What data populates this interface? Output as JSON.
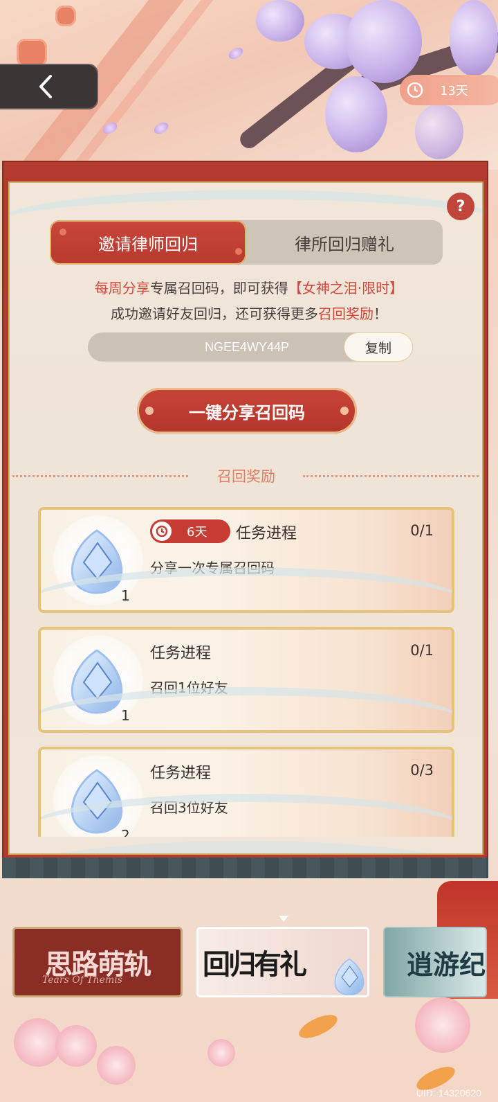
{
  "header": {
    "back_icon": "chevron-left-icon",
    "timer_icon": "clock-icon",
    "timer_text": "13天"
  },
  "panel": {
    "help_icon": "question-icon",
    "help_label": "?",
    "tabs": [
      {
        "label": "邀请律师回归",
        "active": true
      },
      {
        "label": "律所回归赠礼",
        "active": false
      }
    ],
    "description": {
      "line1": {
        "a": "每周",
        "b": "分享",
        "c": "专属召回码，即可获得",
        "d": "【女神之泪·限时】"
      },
      "line2": {
        "a": "成功邀请好友回归，还可获得更多",
        "b": "召回奖励",
        "c": "！"
      }
    },
    "recall_code": "NGEE4WY44P",
    "copy_label": "复制",
    "share_button_label": "一键分享召回码",
    "section_title": "召回奖励",
    "tasks": [
      {
        "title": "任务进程",
        "desc": "分享一次专属召回码",
        "progress": "0/1",
        "count": "1",
        "days": "6天",
        "item_icon": "tear-gem-icon"
      },
      {
        "title": "任务进程",
        "desc": "召回1位好友",
        "progress": "0/1",
        "count": "1",
        "item_icon": "tear-gem-icon"
      },
      {
        "title": "任务进程",
        "desc": "召回3位好友",
        "progress": "0/3",
        "count": "2",
        "item_icon": "tear-gem-icon"
      }
    ]
  },
  "carousel": {
    "banners": [
      {
        "title": "思路萌轨",
        "subtitle": "Tears Of Themis"
      },
      {
        "title": "回归有礼"
      },
      {
        "title": "逍游纪"
      }
    ]
  },
  "footer": {
    "uid": "UID: 14320620"
  },
  "colors": {
    "accent_red": "#c0453a",
    "highlight_red": "#d1473b",
    "gold_border": "#e6c27a",
    "section_title": "#e07e63"
  }
}
